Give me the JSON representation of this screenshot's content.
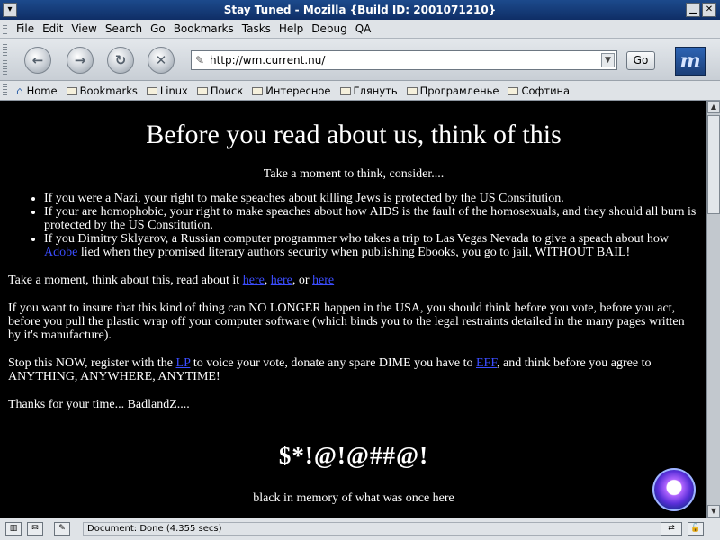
{
  "window": {
    "title": "Stay Tuned - Mozilla {Build ID: 2001071210}"
  },
  "menu": [
    "File",
    "Edit",
    "View",
    "Search",
    "Go",
    "Bookmarks",
    "Tasks",
    "Help",
    "Debug",
    "QA"
  ],
  "nav": {
    "url": "http://wm.current.nu/",
    "go_label": "Go",
    "logo": "m"
  },
  "personal_toolbar": [
    "Home",
    "Bookmarks",
    "Linux",
    "Поиск",
    "Интересное",
    "Глянуть",
    "Програмленье",
    "Софтина"
  ],
  "page": {
    "heading": "Before you read about us, think of this",
    "intro": "Take a moment to think, consider....",
    "bullets": [
      {
        "text": "If you were a Nazi, your right to make speaches about killing Jews is protected by the US Constitution."
      },
      {
        "text": "If your are homophobic, your right to make speaches about how AIDS is the fault of the homosexuals, and they should all burn is protected by the US Constitution."
      },
      {
        "pre": "If you Dimitry Sklyarov, a Russian computer programmer who takes a trip to Las Vegas Nevada to give a speach about how ",
        "link": "Adobe",
        "post": " lied when they promised literary authors security when publishing Ebooks, you go to jail, WITHOUT BAIL!"
      }
    ],
    "para1_pre": "Take a moment, think about this, read about it ",
    "para1_links": [
      "here",
      "here",
      "here"
    ],
    "para1_sep1": ", ",
    "para1_sep2": ", or ",
    "para2": "If you want to insure that this kind of thing can NO LONGER happen in the USA, you should think before you vote, before you act, before you pull the plastic wrap off your computer software (which binds you to the legal restraints detailed in the many pages written by it's manufacture).",
    "para3_pre": "Stop this NOW, register with the ",
    "para3_link1": "LP",
    "para3_mid": " to voice your vote, donate any spare DIME you have to ",
    "para3_link2": "EFF",
    "para3_post": ", and think before you agree to ANYTHING, ANYWHERE, ANYTIME!",
    "thanks": "Thanks for your time... BadlandZ....",
    "symbols": "$*!@!@##@!",
    "memory": "black in memory of what was once here"
  },
  "status": {
    "text": "Document: Done (4.355 secs)"
  }
}
